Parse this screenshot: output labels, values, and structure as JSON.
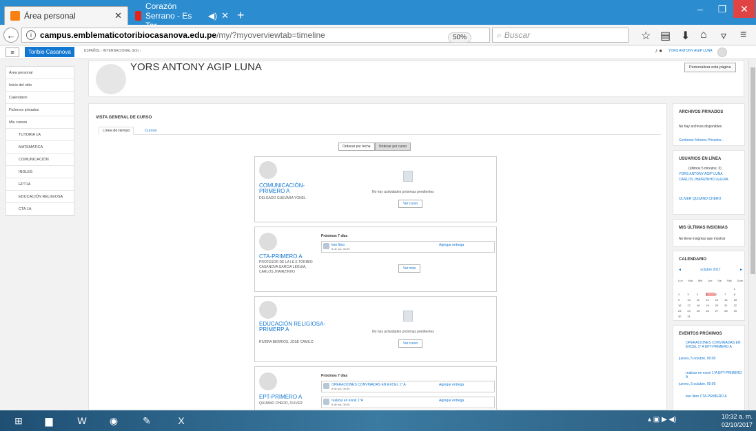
{
  "browser": {
    "tabs": [
      {
        "label": "Área personal"
      },
      {
        "label": "Corazón Serrano - Es Tar"
      }
    ],
    "url_host": "campus.emblematicotoribiocasanova.edu.pe",
    "url_path": "/my/?myoverviewtab=timeline",
    "zoom": "50%",
    "search_placeholder": "Buscar"
  },
  "moodle_bar": {
    "brand": "Toribio Casanova",
    "language": "ESPAÑOL - INTERNACIONAL (ES) ›",
    "user": "YORS ANTONY AGIP LUNA"
  },
  "sidebar": {
    "items": [
      {
        "label": "Área personal",
        "sub": false
      },
      {
        "label": "Inicio del sitio",
        "sub": false
      },
      {
        "label": "Calendario",
        "sub": false
      },
      {
        "label": "Ficheros privados",
        "sub": false
      },
      {
        "label": "Mis cursos",
        "sub": false
      },
      {
        "label": "TUTORIA 1A",
        "sub": true
      },
      {
        "label": "MATEMATICA",
        "sub": true
      },
      {
        "label": "COMUNICACIÓN",
        "sub": true
      },
      {
        "label": "INGLES",
        "sub": true
      },
      {
        "label": "EPT1A",
        "sub": true
      },
      {
        "label": "EDUCACIÓN RELIGIOSA",
        "sub": true
      },
      {
        "label": "CTA 1A",
        "sub": true
      }
    ]
  },
  "header": {
    "name": "YORS ANTONY AGIP LUNA",
    "customize": "Personalizar esta página"
  },
  "overview": {
    "title": "VISTA GENERAL DE CURSO",
    "tab_timeline": "Línea de tiempo",
    "tab_courses": "Cursos",
    "sort_date": "Ordenar por fecha",
    "sort_course": "Ordenar por curso",
    "no_activities": "No hay actividades próximas pendientes",
    "view_course": "Ver curso",
    "view_more": "Ver más",
    "next7": "Próximos 7 días",
    "add_submission": "Agregar entrega",
    "courses": [
      {
        "name": "COMUNICACIÓN-PRIMERO A",
        "teacher": "DELGADO GUEVARA YONEL"
      },
      {
        "name": "CTA-PRIMERO A",
        "teacher": "PROFESOR DE LA I.E.E TORIBIO CASANOVA GARCIA LEGUIA, CARLOS JHAIRZINHO"
      },
      {
        "name": "EDUCACIÓN RELIGIOSA-PRIMERP A",
        "teacher": "RIVERA BERRIOS, JOSE CAMILO"
      },
      {
        "name": "EPT-PRIMERO A",
        "teacher": "QUIJANO CHERO, OLIVER"
      }
    ],
    "events": [
      {
        "name": "leer libro",
        "date": "5 de oct, 00:00"
      },
      {
        "name": "OPERACIONES CONVINADAS EN EXCEL 1° A",
        "date": "5 de oct, 00:00"
      },
      {
        "name": "realizar en excel 1°A",
        "date": "5 de oct, 00:00"
      }
    ]
  },
  "right": {
    "files_title": "ARCHIVOS PRIVADOS",
    "files_none": "No hay archivos disponibles",
    "files_manage": "Gestionar ficheros Privados...",
    "online_title": "USUARIOS EN LÍNEA",
    "online_sub": "(últimos 5 minutos: 3)",
    "online_users": [
      "YORS ANTONY AGIP LUNA",
      "CARLOS JHAIRZINHO LEGUIA",
      "OLIVER QUIJANO CHERO"
    ],
    "badges_title": "MIS ÚLTIMAS INSIGNIAS",
    "badges_none": "No tiene insignias que mostrar",
    "calendar_title": "CALENDARIO",
    "calendar_month": "octubre 2017",
    "calendar_days": [
      "Lun",
      "Mar",
      "Mié",
      "Jue",
      "Vie",
      "Sáb",
      "Dom"
    ],
    "events_title": "EVENTOS PRÓXIMOS",
    "upcoming": [
      {
        "name": "OPERACIONES CONVINADAS EN EXCEL 1° A EPT-PRIMERO A",
        "date": "jueves, 5 octubre, 00:00"
      },
      {
        "name": "realizar en excel 1°A EPT-PRIMERO A",
        "date": "jueves, 5 octubre, 00:00"
      },
      {
        "name": "leer libro CTA-PRIMERO A",
        "date": ""
      }
    ]
  },
  "taskbar": {
    "time": "10:32 a. m.",
    "date": "02/10/2017"
  }
}
